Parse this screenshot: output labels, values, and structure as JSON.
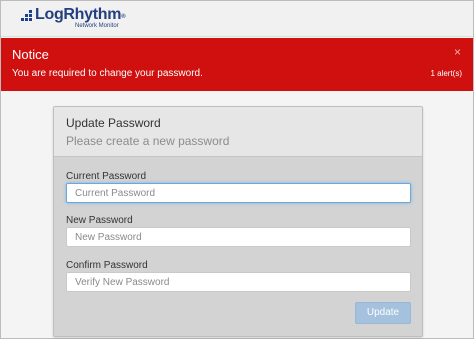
{
  "header": {
    "logo_text": "LogRhythm",
    "logo_tm": "®",
    "logo_subtitle": "Network Monitor"
  },
  "notice": {
    "title": "Notice",
    "message": "You are required to change your password.",
    "close_symbol": "×",
    "alert_count": "1 alert(s)",
    "color": "#d00f0f"
  },
  "form": {
    "title": "Update Password",
    "subtitle": "Please create a new password",
    "current_password": {
      "label": "Current Password",
      "placeholder": "Current Password",
      "value": ""
    },
    "new_password": {
      "label": "New Password",
      "placeholder": "New Password",
      "value": ""
    },
    "confirm_password": {
      "label": "Confirm Password",
      "placeholder": "Verify New Password",
      "value": ""
    },
    "update_label": "Update",
    "accent": "#a4c2dd"
  }
}
